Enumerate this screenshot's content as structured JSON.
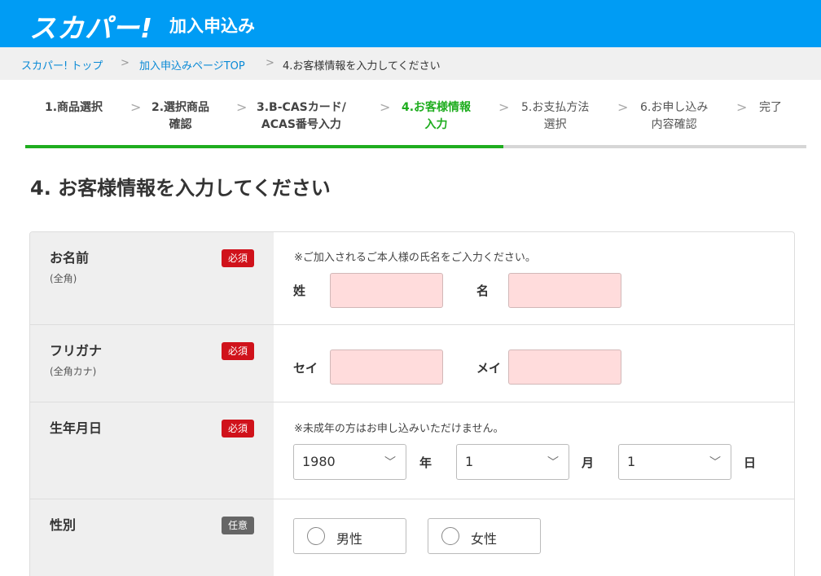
{
  "header": {
    "logo": "スカパー!",
    "title": "加入申込み"
  },
  "breadcrumb": {
    "items": [
      "スカパー! トップ",
      "加入申込みページTOP",
      "4.お客様情報を入力してください"
    ],
    "separator": ">"
  },
  "steps": {
    "separator": ">",
    "items": [
      {
        "line1": "1.商品選択",
        "line2": ""
      },
      {
        "line1": "2.選択商品",
        "line2": "確認"
      },
      {
        "line1": "3.B-CASカード/",
        "line2": "ACAS番号入力"
      },
      {
        "line1": "4.お客様情報",
        "line2": "入力"
      },
      {
        "line1": "5.お支払方法",
        "line2": "選択"
      },
      {
        "line1": "6.お申し込み",
        "line2": "内容確認"
      },
      {
        "line1": "完了",
        "line2": ""
      }
    ],
    "current": 4
  },
  "section_title": "4. お客様情報を入力してください",
  "form": {
    "name": {
      "label": "お名前",
      "sub": "(全角)",
      "badge": "必須",
      "note": "※ご加入されるご本人様の氏名をご入力ください。",
      "last_label": "姓",
      "first_label": "名",
      "last_value": "",
      "first_value": ""
    },
    "kana": {
      "label": "フリガナ",
      "sub": "(全角カナ)",
      "badge": "必須",
      "last_label": "セイ",
      "first_label": "メイ",
      "last_value": "",
      "first_value": ""
    },
    "birth": {
      "label": "生年月日",
      "badge": "必須",
      "note": "※未成年の方はお申し込みいただけません。",
      "year": "1980",
      "year_unit": "年",
      "month": "1",
      "month_unit": "月",
      "day": "1",
      "day_unit": "日"
    },
    "gender": {
      "label": "性別",
      "badge": "任意",
      "options": [
        "男性",
        "女性"
      ]
    }
  },
  "colors": {
    "header": "#009cf4",
    "active_step": "#1fad1f",
    "required": "#d0121b",
    "optional": "#666666",
    "input_bg": "#ffdcdc"
  },
  "icons": {
    "breadcrumb_sep": "chevron-right-icon",
    "select": "chevron-down-icon",
    "radio": "radio-icon"
  }
}
